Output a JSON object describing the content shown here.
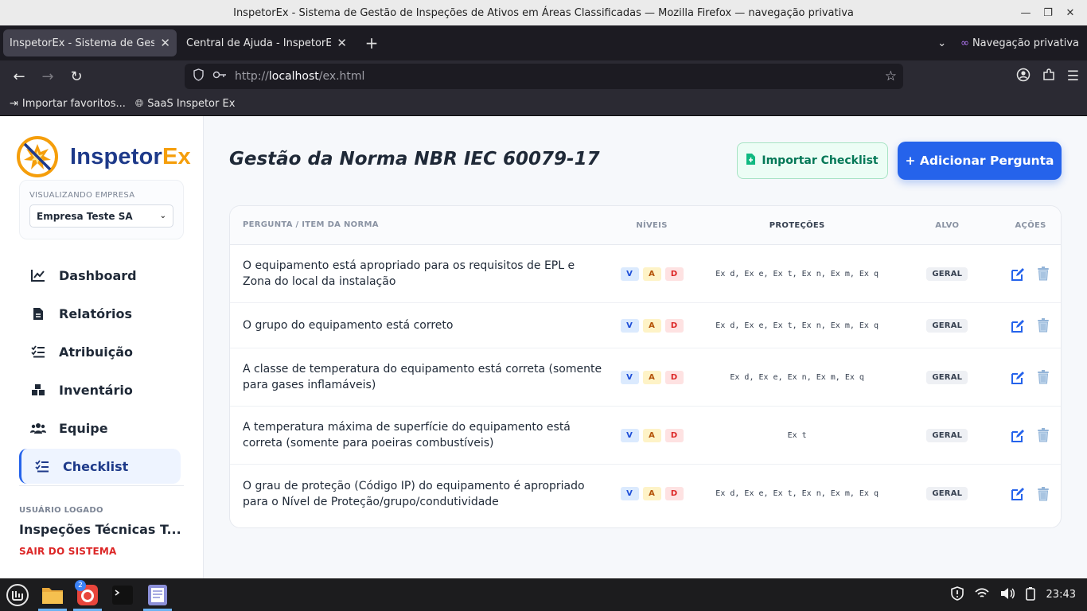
{
  "window": {
    "title": "InspetorEx - Sistema de Gestão de Inspeções de Ativos em Áreas Classificadas — Mozilla Firefox — navegação privativa"
  },
  "browser": {
    "tabs": [
      {
        "label": "InspetorEx - Sistema de Gestão de Inspeções",
        "active": true
      },
      {
        "label": "Central de Ajuda - InspetorEx",
        "active": false
      }
    ],
    "private_label": "Navegação privativa",
    "url_proto": "http://",
    "url_host": "localhost",
    "url_path": "/ex.html",
    "bookmarks": [
      {
        "label": "Importar favoritos..."
      },
      {
        "label": "SaaS Inspetor Ex"
      }
    ]
  },
  "sidebar": {
    "logo_main": "Inspetor",
    "logo_accent": "Ex",
    "company_label": "VISUALIZANDO EMPRESA",
    "company_selected": "Empresa Teste SA",
    "nav": [
      {
        "label": "Dashboard",
        "icon": "chart-line-icon"
      },
      {
        "label": "Relatórios",
        "icon": "file-icon"
      },
      {
        "label": "Atribuição",
        "icon": "list-check-icon"
      },
      {
        "label": "Inventário",
        "icon": "boxes-icon"
      },
      {
        "label": "Equipe",
        "icon": "users-icon"
      },
      {
        "label": "Checklist",
        "icon": "list-check-icon",
        "active": true
      }
    ],
    "user_label": "USUÁRIO LOGADO",
    "user_name": "Inspeções Técnicas Terceirizadas",
    "logout": "SAIR DO SISTEMA"
  },
  "main": {
    "title": "Gestão da Norma NBR IEC 60079-17",
    "import_button": "Importar Checklist",
    "add_button": "+ Adicionar Pergunta",
    "columns": {
      "question": "PERGUNTA / ITEM DA NORMA",
      "levels": "NÍVEIS",
      "protections": "PROTEÇÕES",
      "target": "ALVO",
      "actions": "AÇÕES"
    },
    "rows": [
      {
        "question": "O equipamento está apropriado para os requisitos de EPL e Zona do local da instalação",
        "levels": [
          "V",
          "A",
          "D"
        ],
        "protections": "Ex d, Ex e, Ex t, Ex n, Ex m, Ex q",
        "target": "GERAL"
      },
      {
        "question": "O grupo do equipamento está correto",
        "levels": [
          "V",
          "A",
          "D"
        ],
        "protections": "Ex d, Ex e, Ex t, Ex n, Ex m, Ex q",
        "target": "GERAL"
      },
      {
        "question": "A classe de temperatura do equipamento está correta (somente para gases inflamáveis)",
        "levels": [
          "V",
          "A",
          "D"
        ],
        "protections": "Ex d, Ex e, Ex n, Ex m, Ex q",
        "target": "GERAL"
      },
      {
        "question": "A temperatura máxima de superfície do equipamento está correta (somente para poeiras combustíveis)",
        "levels": [
          "V",
          "A",
          "D"
        ],
        "protections": "Ex t",
        "target": "GERAL"
      },
      {
        "question": "O grau de proteção (Código IP) do equipamento é apropriado para o Nível de Proteção/grupo/condutividade",
        "levels": [
          "V",
          "A",
          "D"
        ],
        "protections": "Ex d, Ex e, Ex t, Ex n, Ex m, Ex q",
        "target": "GERAL"
      }
    ]
  },
  "taskbar": {
    "badge": "2",
    "clock": "23:43"
  },
  "colors": {
    "primary": "#2563eb",
    "brand_dark": "#1e3a8a",
    "brand_accent": "#f59e0b",
    "danger": "#dc2626",
    "success": "#047857"
  }
}
